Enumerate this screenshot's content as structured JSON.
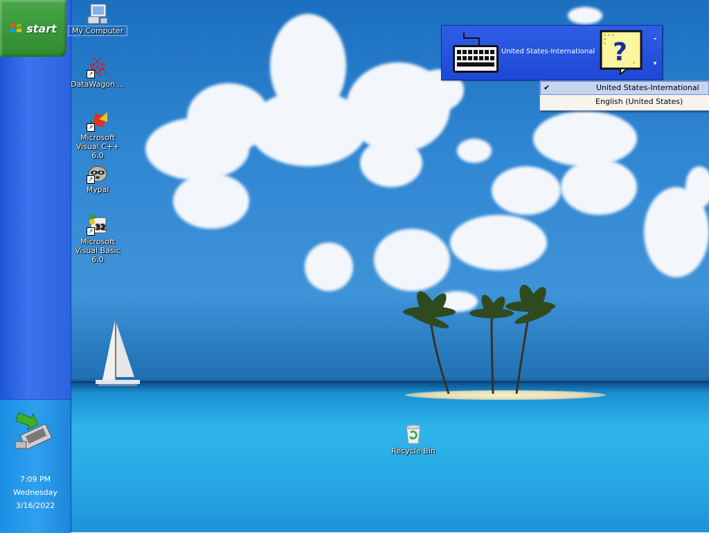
{
  "taskbar": {
    "start_label": "start",
    "clock": {
      "time": "7:09 PM",
      "day": "Wednesday",
      "date": "3/16/2022"
    }
  },
  "desktop_icons": [
    {
      "name": "my-computer",
      "label": "My Computer",
      "icon": "computer-icon",
      "shortcut": false
    },
    {
      "name": "datawagon",
      "label": "DataWagon ...",
      "icon": "datawagon-icon",
      "shortcut": true
    },
    {
      "name": "msvc",
      "label": "Microsoft Visual C++ 6.0",
      "icon": "visual-cpp-icon",
      "shortcut": true
    },
    {
      "name": "mypal",
      "label": "Mypal",
      "icon": "raccoon-icon",
      "shortcut": true
    },
    {
      "name": "msvb",
      "label": "Microsoft Visual Basic 6.0",
      "icon": "visual-basic-icon",
      "shortcut": true
    },
    {
      "name": "recycle-bin",
      "label": "Recycle Bin",
      "icon": "recycle-bin-icon",
      "shortcut": false
    }
  ],
  "language_bar": {
    "current_language": "United States-International",
    "minimize_glyph": "-",
    "options_glyph": "▾",
    "menu": [
      {
        "label": "United States-International",
        "checked": true
      },
      {
        "label": "English (United States)",
        "checked": false
      }
    ],
    "check_glyph": "✔"
  },
  "colors": {
    "taskbar_blue": "#2c63e0",
    "start_green": "#3a9a3a",
    "tray_blue": "#2fa0ee",
    "menu_highlight": "#c6d4f0"
  }
}
